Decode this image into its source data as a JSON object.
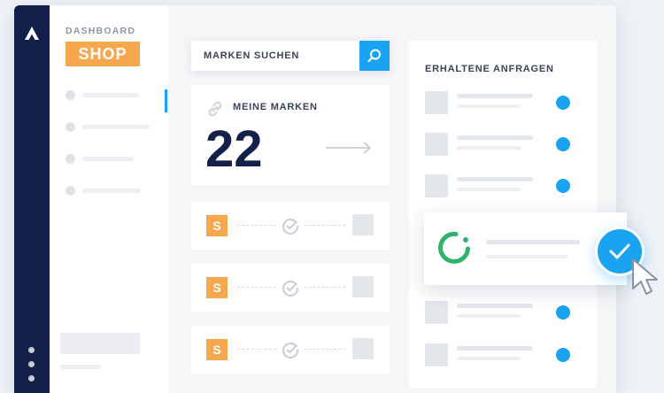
{
  "sidebar": {
    "section_label": "DASHBOARD",
    "badge_label": "SHOP"
  },
  "search": {
    "placeholder": "MARKEN SUCHEN",
    "icon": "search-icon"
  },
  "brands_card": {
    "title": "MEINE MARKEN",
    "count": "22",
    "icon": "link-icon"
  },
  "brand_rows": [
    {
      "badge": "S"
    },
    {
      "badge": "S"
    },
    {
      "badge": "S"
    }
  ],
  "requests": {
    "title": "ERHALTENE ANFRAGEN"
  },
  "colors": {
    "navy": "#13214a",
    "accent_blue": "#1aa3f0",
    "orange": "#f7a84e",
    "green": "#2db36a"
  }
}
